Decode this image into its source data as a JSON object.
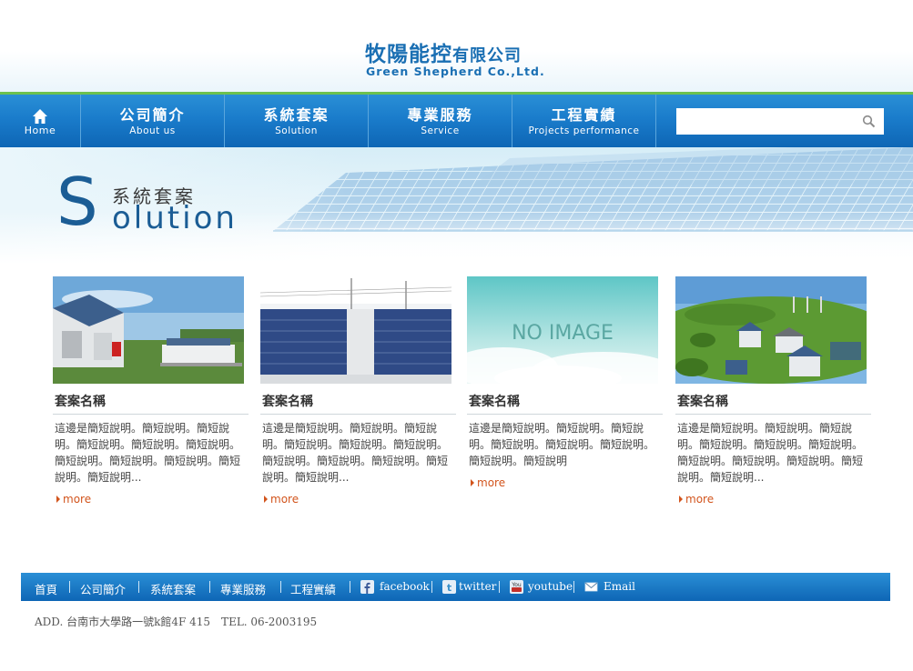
{
  "header": {
    "logo_cn_main": "牧陽能控",
    "logo_cn_suffix": "有限公司",
    "logo_en": "Green Shepherd Co.,Ltd."
  },
  "nav": {
    "home": {
      "icon": "home-icon",
      "en": "Home"
    },
    "items": [
      {
        "cn": "公司簡介",
        "en": "About us"
      },
      {
        "cn": "系統套案",
        "en": "Solution"
      },
      {
        "cn": "專業服務",
        "en": "Service"
      },
      {
        "cn": "工程實績",
        "en": "Projects performance"
      }
    ],
    "search": {
      "placeholder": "",
      "value": "",
      "icon": "search-icon"
    }
  },
  "banner": {
    "letter": "S",
    "title_cn": "系統套案",
    "title_en": "olution"
  },
  "cards": [
    {
      "image": "house-solar-panels",
      "title": "套案名稱",
      "desc": "這邊是簡短說明。簡短說明。簡短說明。簡短說明。簡短說明。簡短說明。簡短說明。簡短說明。簡短說明。簡短說明。簡短說明...",
      "more": "more"
    },
    {
      "image": "solar-farm-powerline",
      "title": "套案名稱",
      "desc": "這邊是簡短說明。簡短說明。簡短說明。簡短說明。簡短說明。簡短說明。簡短說明。簡短說明。簡短說明。簡短說明。簡短說明...",
      "more": "more"
    },
    {
      "image": "no-image-placeholder",
      "image_text": "NO IMAGE",
      "title": "套案名稱",
      "desc": "這邊是簡短說明。簡短說明。簡短說明。簡短說明。簡短說明。簡短說明。簡短說明。簡短說明",
      "more": "more"
    },
    {
      "image": "village-solar-houses",
      "title": "套案名稱",
      "desc": "這邊是簡短說明。簡短說明。簡短說明。簡短說明。簡短說明。簡短說明。簡短說明。簡短說明。簡短說明。簡短說明。簡短說明...",
      "more": "more"
    }
  ],
  "footer": {
    "links": [
      "首頁",
      "公司簡介",
      "系統套案",
      "專業服務",
      "工程實績"
    ],
    "social": [
      {
        "icon": "facebook-icon",
        "label": "facebook"
      },
      {
        "icon": "twitter-icon",
        "label": "twitter"
      },
      {
        "icon": "youtube-icon",
        "label": "youtube"
      },
      {
        "icon": "email-icon",
        "label": "Email"
      }
    ],
    "address": "ADD. 台南市大學路一號k館4F 415　TEL. 06-2003195"
  },
  "colors": {
    "brand_blue": "#1a6fb3",
    "nav_blue": "#1a7ccb",
    "accent_green": "#6cc14e",
    "more_orange": "#d2541c"
  }
}
